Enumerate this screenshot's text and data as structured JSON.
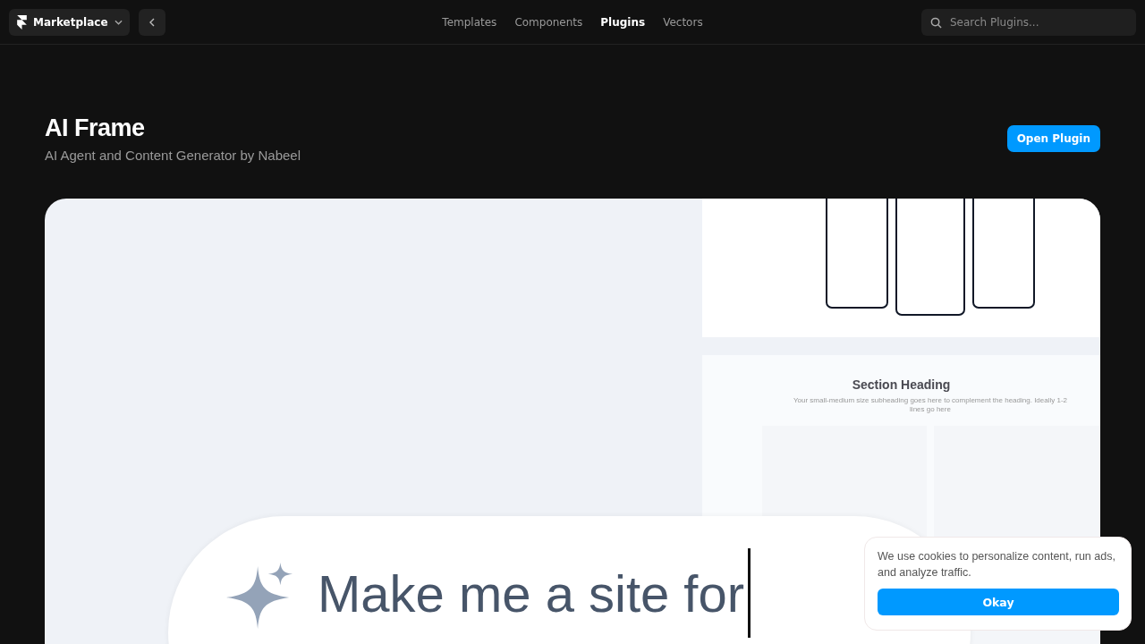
{
  "header": {
    "brand": "Marketplace",
    "nav": [
      {
        "label": "Templates",
        "selected": false
      },
      {
        "label": "Components",
        "selected": false
      },
      {
        "label": "Plugins",
        "selected": true
      },
      {
        "label": "Vectors",
        "selected": false
      }
    ],
    "search": {
      "placeholder": "Search Plugins..."
    }
  },
  "plugin": {
    "title": "AI Frame",
    "subtitle": "AI Agent and Content Generator by Nabeel",
    "action": "Open Plugin"
  },
  "preview": {
    "section_heading": "Section Heading",
    "section_subheading": "Your small-medium size subheading goes here to complement the heading. Ideally 1-2 lines go here",
    "prompt": "Make me a site for"
  },
  "cookie_banner": {
    "message": "We use cookies to personalize content, run ads, and analyze traffic.",
    "button": "Okay"
  }
}
